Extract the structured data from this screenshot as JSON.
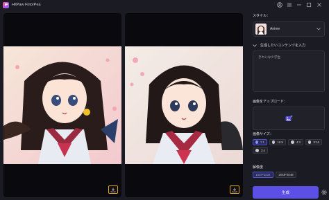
{
  "window": {
    "title": "HitPaw FotorPea"
  },
  "panels": [
    {
      "name": "result-image-1"
    },
    {
      "name": "result-image-2"
    }
  ],
  "sidebar": {
    "style_label": "スタイル：",
    "style_value": "Anime",
    "prompt_label": "生成したいコンテンツを入力",
    "prompt_value": "きれいな少学生",
    "upload_label": "画像をアップロード：",
    "size_label": "画像サイズ：",
    "sizes": [
      {
        "label": "1:1",
        "active": true
      },
      {
        "label": "16:9",
        "active": false
      },
      {
        "label": "4:3",
        "active": false
      },
      {
        "label": "9:16",
        "active": false
      },
      {
        "label": "3:4",
        "active": false
      }
    ],
    "resolution_label": "解像度",
    "resolutions": [
      {
        "label": "1024*1024",
        "active": true
      },
      {
        "label": "2048*2048",
        "active": false
      }
    ],
    "generate_label": "生成"
  },
  "colors": {
    "accent": "#5b4fe6",
    "download_border": "#e6a81a",
    "background": "#1b1b23"
  },
  "icons": [
    "app-logo-icon",
    "account-icon",
    "menu-icon",
    "minimize-icon",
    "maximize-icon",
    "close-icon",
    "download-icon",
    "chevron-down-icon",
    "upload-image-icon",
    "settings-icon"
  ]
}
